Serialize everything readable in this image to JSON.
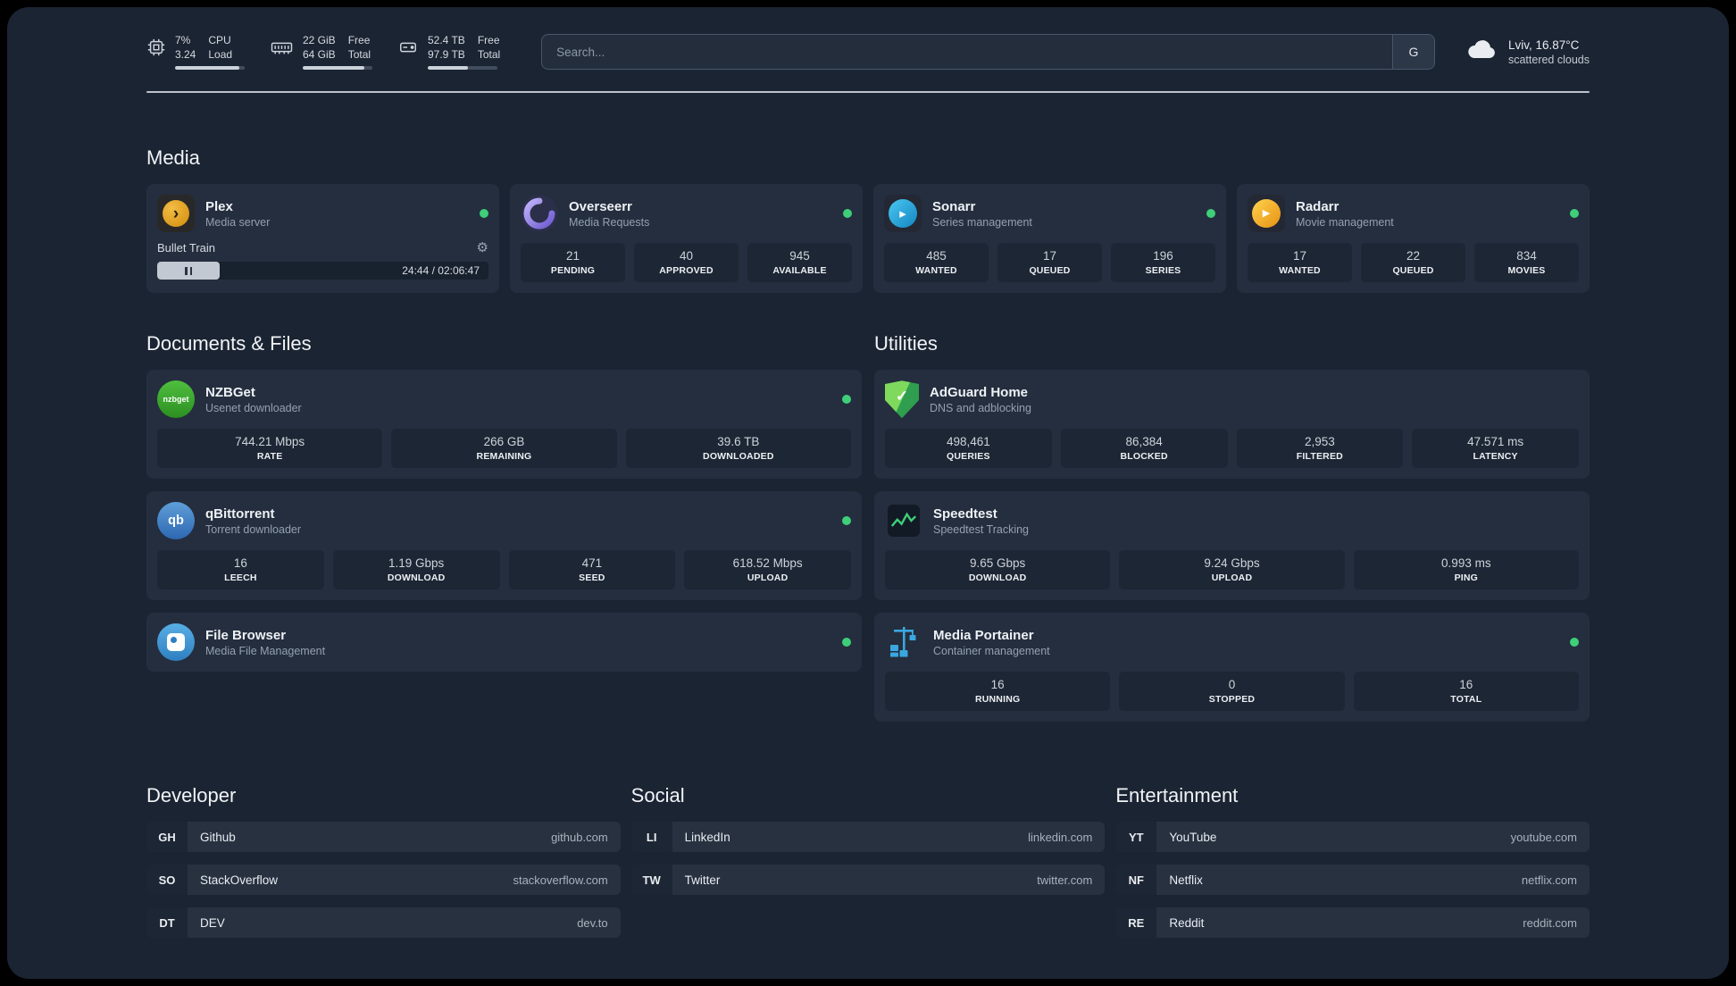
{
  "topbar": {
    "cpu": {
      "value_top": "7%",
      "value_bottom": "3.24",
      "label_top": "CPU",
      "label_bottom": "Load",
      "progress": 92
    },
    "memory": {
      "value_top": "22 GiB",
      "value_bottom": "64 GiB",
      "label_top": "Free",
      "label_bottom": "Total",
      "progress": 88
    },
    "disk": {
      "value_top": "52.4 TB",
      "value_bottom": "97.9 TB",
      "label_top": "Free",
      "label_bottom": "Total",
      "progress": 58
    },
    "search": {
      "placeholder": "Search...",
      "engine_button": "G"
    },
    "weather": {
      "location": "Lviv, 16.87°C",
      "condition": "scattered clouds"
    }
  },
  "sections": {
    "media": {
      "title": "Media"
    },
    "documents": {
      "title": "Documents & Files"
    },
    "utilities": {
      "title": "Utilities"
    },
    "developer": {
      "title": "Developer"
    },
    "social": {
      "title": "Social"
    },
    "entertainment": {
      "title": "Entertainment"
    }
  },
  "colors": {
    "background": "#1b2432",
    "card": "#242e3e",
    "tile": "#1d2634",
    "status_ok": "#3ecf79"
  },
  "apps": {
    "plex": {
      "name": "Plex",
      "subtitle": "Media server",
      "icon_glyph": "›",
      "player": {
        "track": "Bullet Train",
        "time": "24:44 / 02:06:47",
        "progress": 19
      }
    },
    "overseerr": {
      "name": "Overseerr",
      "subtitle": "Media Requests",
      "stats": [
        {
          "value": "21",
          "label": "PENDING"
        },
        {
          "value": "40",
          "label": "APPROVED"
        },
        {
          "value": "945",
          "label": "AVAILABLE"
        }
      ]
    },
    "sonarr": {
      "name": "Sonarr",
      "subtitle": "Series management",
      "icon_glyph": "▸",
      "stats": [
        {
          "value": "485",
          "label": "WANTED"
        },
        {
          "value": "17",
          "label": "QUEUED"
        },
        {
          "value": "196",
          "label": "SERIES"
        }
      ]
    },
    "radarr": {
      "name": "Radarr",
      "subtitle": "Movie management",
      "icon_glyph": "▶",
      "stats": [
        {
          "value": "17",
          "label": "WANTED"
        },
        {
          "value": "22",
          "label": "QUEUED"
        },
        {
          "value": "834",
          "label": "MOVIES"
        }
      ]
    },
    "nzbget": {
      "name": "NZBGet",
      "subtitle": "Usenet downloader",
      "icon_glyph": "nzbget",
      "stats": [
        {
          "value": "744.21 Mbps",
          "label": "RATE"
        },
        {
          "value": "266 GB",
          "label": "REMAINING"
        },
        {
          "value": "39.6 TB",
          "label": "DOWNLOADED"
        }
      ]
    },
    "qbittorrent": {
      "name": "qBittorrent",
      "subtitle": "Torrent downloader",
      "icon_glyph": "qb",
      "stats": [
        {
          "value": "16",
          "label": "LEECH"
        },
        {
          "value": "1.19 Gbps",
          "label": "DOWNLOAD"
        },
        {
          "value": "471",
          "label": "SEED"
        },
        {
          "value": "618.52 Mbps",
          "label": "UPLOAD"
        }
      ]
    },
    "filebrowser": {
      "name": "File Browser",
      "subtitle": "Media File Management"
    },
    "adguard": {
      "name": "AdGuard Home",
      "subtitle": "DNS and adblocking",
      "icon_glyph": "✓",
      "stats": [
        {
          "value": "498,461",
          "label": "QUERIES"
        },
        {
          "value": "86,384",
          "label": "BLOCKED"
        },
        {
          "value": "2,953",
          "label": "FILTERED"
        },
        {
          "value": "47.571 ms",
          "label": "LATENCY"
        }
      ]
    },
    "speedtest": {
      "name": "Speedtest",
      "subtitle": "Speedtest Tracking",
      "stats": [
        {
          "value": "9.65 Gbps",
          "label": "DOWNLOAD"
        },
        {
          "value": "9.24 Gbps",
          "label": "UPLOAD"
        },
        {
          "value": "0.993 ms",
          "label": "PING"
        }
      ]
    },
    "portainer": {
      "name": "Media Portainer",
      "subtitle": "Container management",
      "stats": [
        {
          "value": "16",
          "label": "RUNNING"
        },
        {
          "value": "0",
          "label": "STOPPED"
        },
        {
          "value": "16",
          "label": "TOTAL"
        }
      ]
    }
  },
  "bookmarks": {
    "developer": [
      {
        "abbr": "GH",
        "name": "Github",
        "url": "github.com"
      },
      {
        "abbr": "SO",
        "name": "StackOverflow",
        "url": "stackoverflow.com"
      },
      {
        "abbr": "DT",
        "name": "DEV",
        "url": "dev.to"
      }
    ],
    "social": [
      {
        "abbr": "LI",
        "name": "LinkedIn",
        "url": "linkedin.com"
      },
      {
        "abbr": "TW",
        "name": "Twitter",
        "url": "twitter.com"
      }
    ],
    "entertainment": [
      {
        "abbr": "YT",
        "name": "YouTube",
        "url": "youtube.com"
      },
      {
        "abbr": "NF",
        "name": "Netflix",
        "url": "netflix.com"
      },
      {
        "abbr": "RE",
        "name": "Reddit",
        "url": "reddit.com"
      }
    ]
  }
}
